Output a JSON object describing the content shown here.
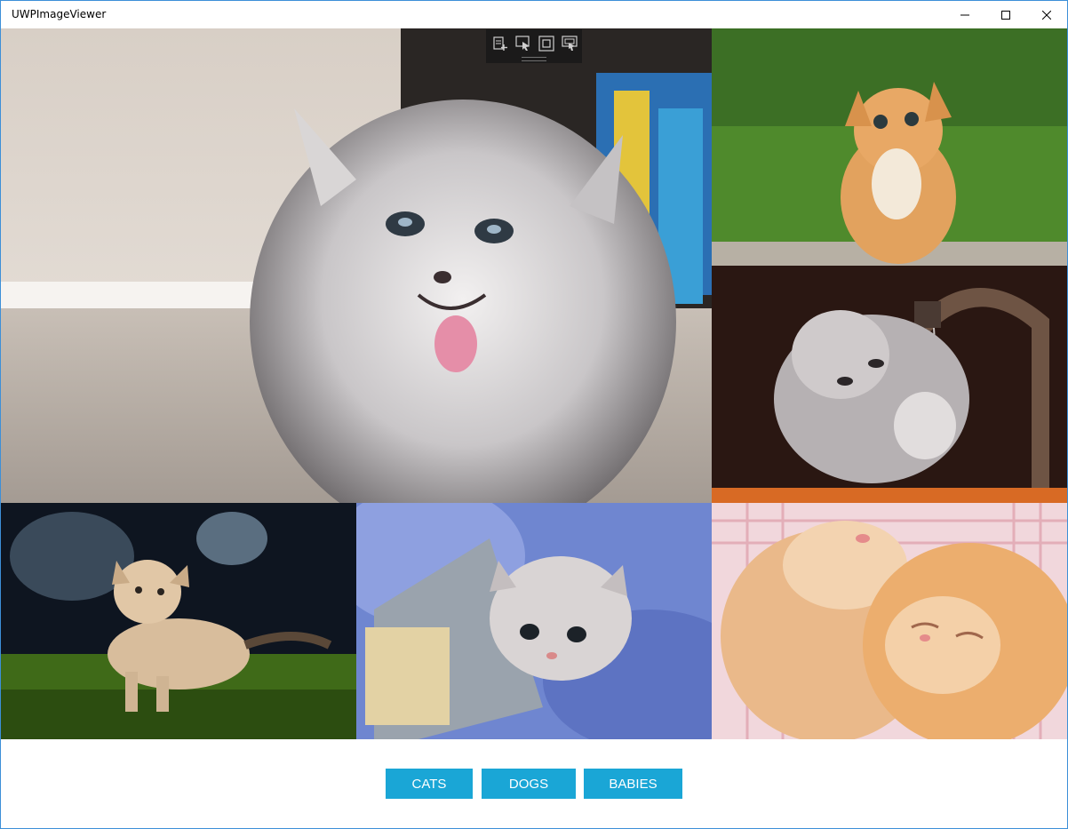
{
  "window": {
    "title": "UWPImageViewer",
    "accent_color": "#3c8fd8"
  },
  "caption_buttons": {
    "minimize_icon": "minimize-icon",
    "maximize_icon": "maximize-icon",
    "close_icon": "close-icon"
  },
  "debug_toolbar": {
    "icons": [
      "live-visual-tree-icon",
      "select-element-icon",
      "display-layout-adorners-icon",
      "track-focused-element-icon"
    ]
  },
  "gallery": {
    "images": [
      {
        "subject": "fluffy grey kitten with tongue out"
      },
      {
        "subject": "orange kitten on grass"
      },
      {
        "subject": "grey kitten at water faucet"
      },
      {
        "subject": "cream kitten in grass"
      },
      {
        "subject": "grey kitten in blue yarn with tin can"
      },
      {
        "subject": "two sleeping orange kittens"
      }
    ]
  },
  "category_buttons": {
    "cats": "CATS",
    "dogs": "DOGS",
    "babies": "BABIES",
    "color": "#1aa6d6"
  }
}
